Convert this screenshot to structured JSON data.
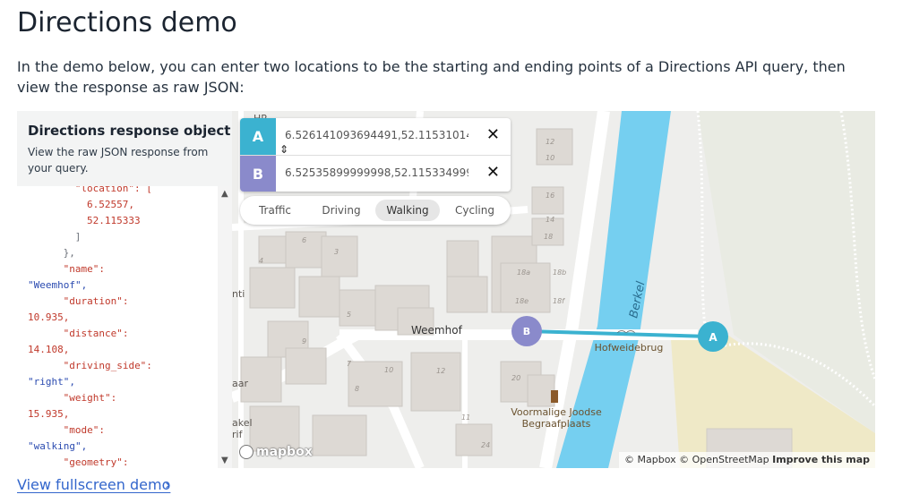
{
  "page": {
    "title": "Directions demo",
    "intro": "In the demo below, you can enter two locations to be the starting and ending points of a Directions API query, then view the response as raw JSON:",
    "footer_link": "View fullscreen demo",
    "footer_chevron": "›"
  },
  "json_panel": {
    "title": "Directions response object",
    "description": "View the raw JSON response from your query.",
    "code_lines": [
      {
        "indent": 8,
        "text": "\"location\": [",
        "cls": "k"
      },
      {
        "indent": 10,
        "text": "6.52557,",
        "cls": "n"
      },
      {
        "indent": 10,
        "text": "52.115333",
        "cls": "n"
      },
      {
        "indent": 8,
        "text": "]",
        "cls": ""
      },
      {
        "indent": 6,
        "text": "},",
        "cls": ""
      },
      {
        "indent": 6,
        "text": "\"name\":",
        "cls": "k"
      },
      {
        "indent": 0,
        "text": "\"Weemhof\",",
        "cls": "s"
      },
      {
        "indent": 6,
        "text": "\"duration\":",
        "cls": "k"
      },
      {
        "indent": 0,
        "text": "10.935,",
        "cls": "n"
      },
      {
        "indent": 6,
        "text": "\"distance\":",
        "cls": "k"
      },
      {
        "indent": 0,
        "text": "14.108,",
        "cls": "n"
      },
      {
        "indent": 6,
        "text": "\"driving_side\":",
        "cls": "k"
      },
      {
        "indent": 0,
        "text": "\"right\",",
        "cls": "s"
      },
      {
        "indent": 6,
        "text": "\"weight\":",
        "cls": "k"
      },
      {
        "indent": 0,
        "text": "15.935,",
        "cls": "n"
      },
      {
        "indent": 6,
        "text": "\"mode\":",
        "cls": "k"
      },
      {
        "indent": 0,
        "text": "\"walking\",",
        "cls": "s"
      },
      {
        "indent": 6,
        "text": "\"geometry\":",
        "cls": "k"
      }
    ]
  },
  "geocoder": {
    "origin_label": "A",
    "origin_value": "6.526141093694491,52.115310140 ...",
    "destination_label": "B",
    "destination_value": "6.52535899999998,52.1153349999 ...",
    "clear_symbol": "✕",
    "swap_symbol": "⇕"
  },
  "profiles": [
    {
      "label": "Traffic",
      "active": false
    },
    {
      "label": "Driving",
      "active": false
    },
    {
      "label": "Walking",
      "active": true
    },
    {
      "label": "Cycling",
      "active": false
    }
  ],
  "map": {
    "street_weemhof": "Weemhof",
    "river_berkel": "Berkel",
    "bridge_label": "Hofweidebrug",
    "poi_line1": "Voormalige Joodse",
    "poi_line2": "Begraafplaats",
    "marker_a": "A",
    "marker_b": "B",
    "route_color": "#3bb2d0",
    "water_color": "#75cff0",
    "house_numbers": [
      "6",
      "4",
      "3",
      "5",
      "7",
      "9",
      "11",
      "10",
      "12",
      "20",
      "24",
      "8",
      "18a",
      "18b",
      "18e",
      "18f",
      "16",
      "14",
      "12",
      "10",
      "18"
    ],
    "edge_text": [
      "nti",
      "aar",
      "akel",
      "rif",
      "HR"
    ],
    "logo": "mapbox",
    "attribution": "© Mapbox © OpenStreetMap",
    "improve": "Improve this map"
  }
}
